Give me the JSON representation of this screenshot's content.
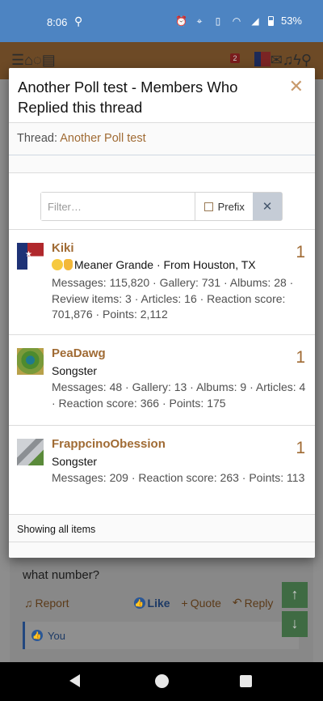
{
  "status_bar": {
    "time": "8:06",
    "battery_pct": "53%"
  },
  "overlay": {
    "title": "Another Poll test - Members Who Replied this thread",
    "close_symbol": "✕",
    "thread_label": "Thread: ",
    "thread_link": "Another Poll test",
    "filter": {
      "placeholder": "Filter…",
      "prefix_label": "Prefix",
      "clear_symbol": "✕"
    },
    "members": [
      {
        "name": "Kiki",
        "title": "Meaner Grande · From Houston, TX",
        "stats": "Messages: 115,820 · Gallery: 731 · Albums: 28 · Review items: 3 · Articles: 16 · Reaction score: 701,876 · Points: 2,112",
        "count": "1"
      },
      {
        "name": "PeaDawg",
        "title": "Songster",
        "stats": "Messages: 48 · Gallery: 13 · Albums: 9 · Articles: 4 · Reaction score: 366 · Points: 175",
        "count": "1"
      },
      {
        "name": "FrappcinoObession",
        "title": "Songster",
        "stats": "Messages: 209 · Reaction score: 263 · Points: 113",
        "count": "1"
      }
    ],
    "footer": "Showing all items"
  },
  "background_post": {
    "text": "what number?",
    "report": "Report",
    "like": "Like",
    "quote": "Quote",
    "reply": "Reply",
    "liked_by": "You"
  },
  "colors": {
    "accent": "#a06b34",
    "header_bar": "#4d84c2"
  }
}
